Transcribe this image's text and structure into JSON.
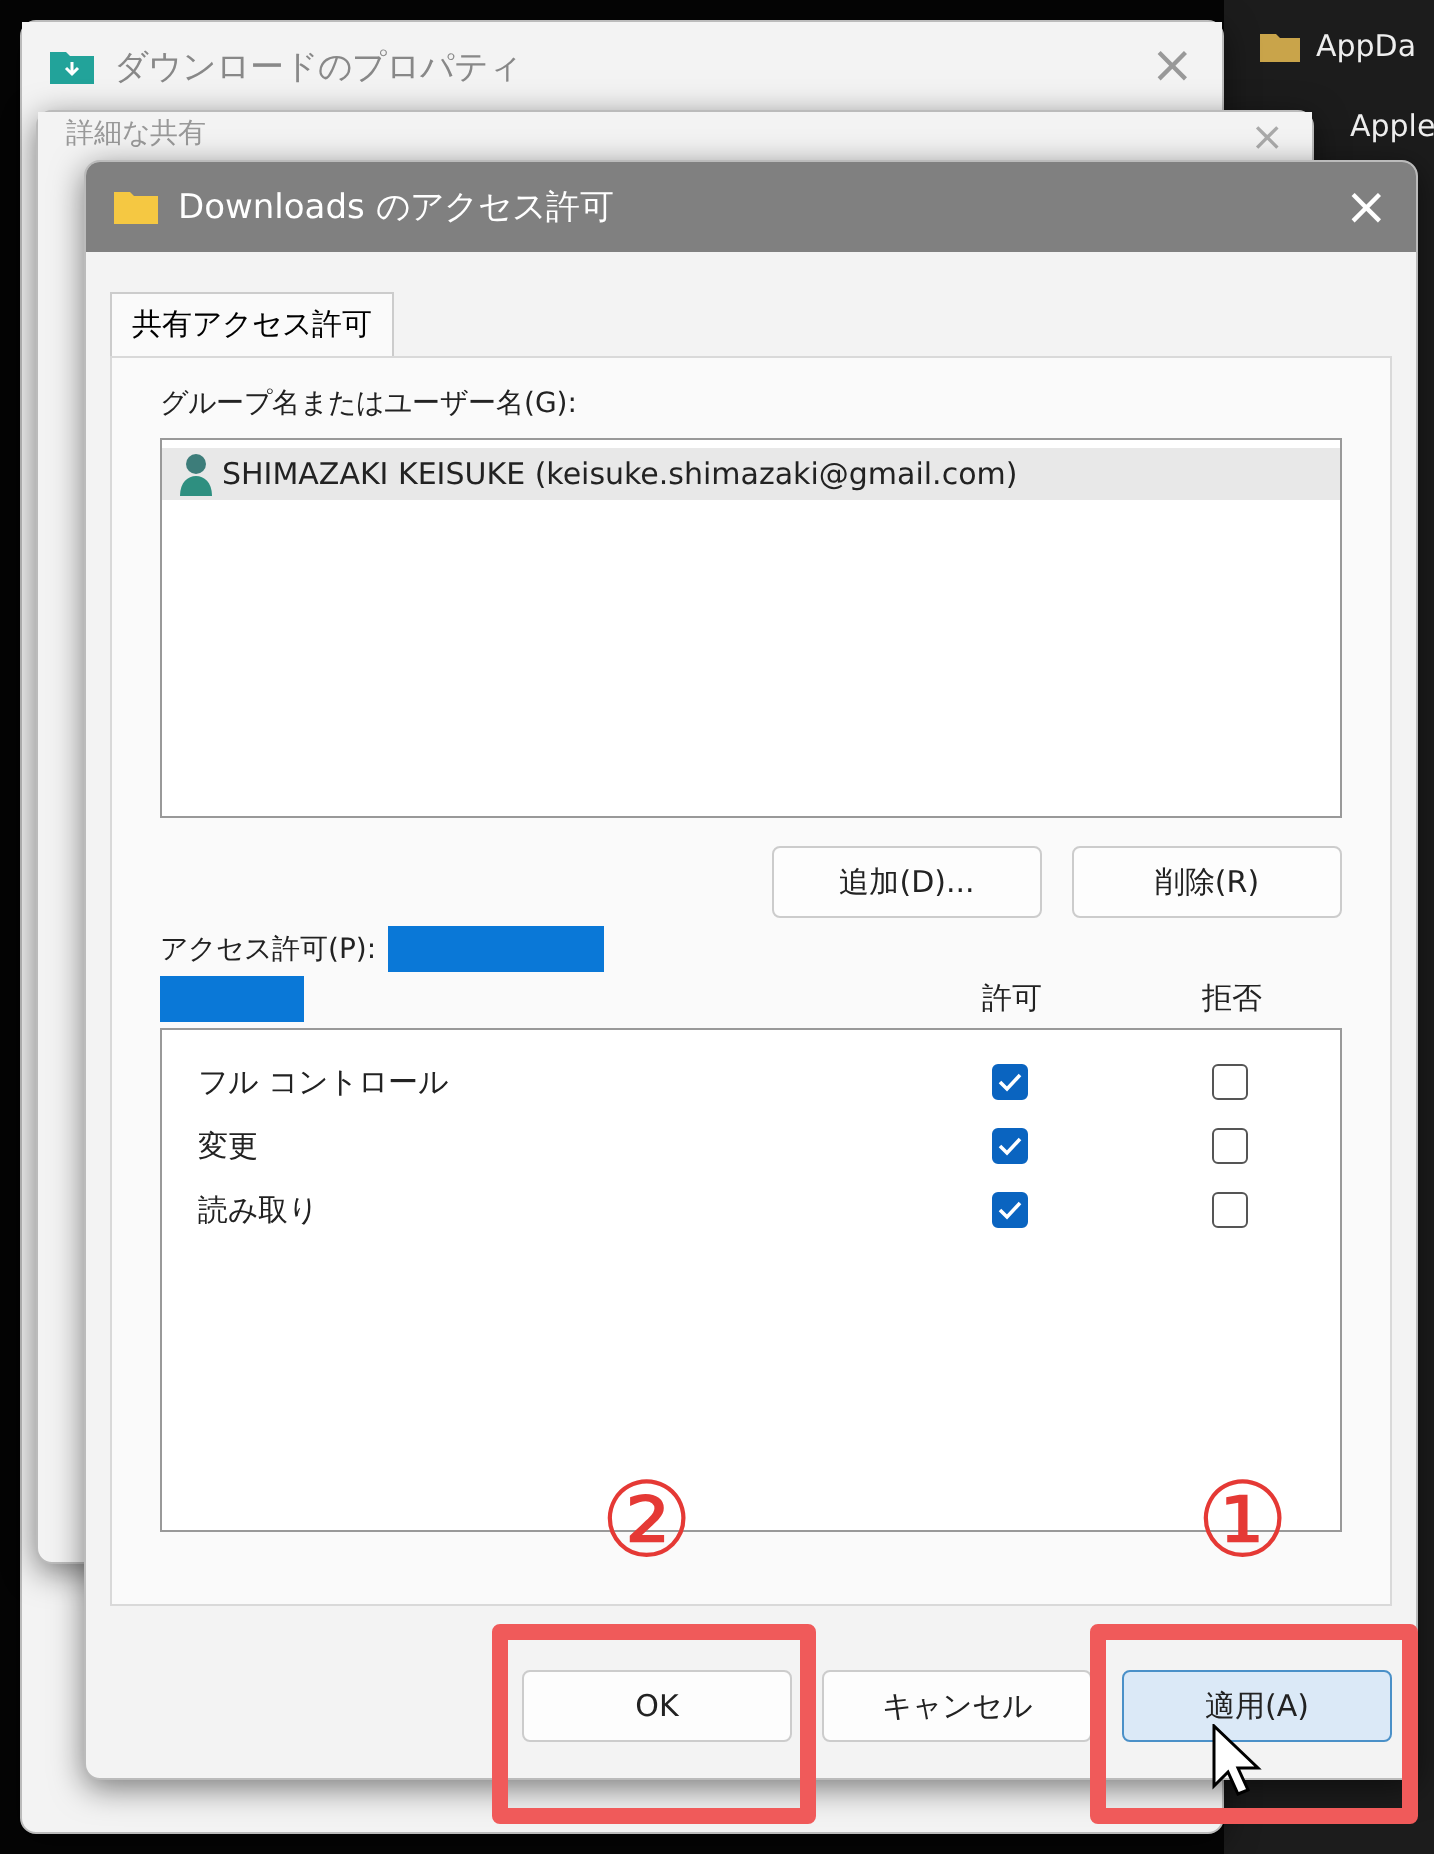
{
  "explorer": {
    "items": [
      {
        "label": "AppDa"
      },
      {
        "label": "Apple"
      }
    ]
  },
  "back_window": {
    "title": "ダウンロードのプロパティ",
    "close": "×"
  },
  "middle_window": {
    "title": "詳細な共有",
    "close": "×"
  },
  "dialog": {
    "title": "Downloads のアクセス許可",
    "close": "×",
    "tabs": [
      {
        "label": "共有アクセス許可",
        "selected": true
      }
    ],
    "group_label": "グループ名またはユーザー名(G):",
    "users": [
      {
        "name": "SHIMAZAKI KEISUKE (keisuke.shimazaki@gmail.com)",
        "selected": true
      }
    ],
    "user_buttons": [
      "追加(D)...",
      "削除(R)"
    ],
    "permissions_label": "アクセス許可(P):",
    "columns": [
      "許可",
      "拒否"
    ],
    "permissions": [
      {
        "name": "フル コントロール",
        "allow": true,
        "deny": false
      },
      {
        "name": "変更",
        "allow": true,
        "deny": false
      },
      {
        "name": "読み取り",
        "allow": true,
        "deny": false
      }
    ],
    "buttons": [
      {
        "label": "OK",
        "selected": false
      },
      {
        "label": "キャンセル",
        "selected": false
      },
      {
        "label": "適用(A)",
        "selected": true
      }
    ]
  },
  "annotations": [
    {
      "mark": "②"
    },
    {
      "mark": "①"
    }
  ]
}
